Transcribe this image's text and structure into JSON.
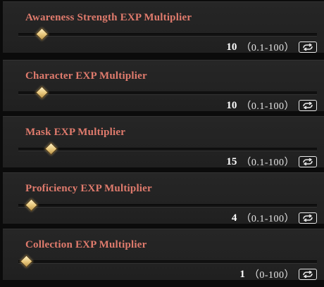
{
  "settings": [
    {
      "label": "Awareness Strength EXP Multiplier",
      "value": "10",
      "range": "（0.1-100）",
      "slider_fraction": 0.099
    },
    {
      "label": "Character EXP Multiplier",
      "value": "10",
      "range": "（0.1-100）",
      "slider_fraction": 0.099
    },
    {
      "label": "Mask EXP Multiplier",
      "value": "15",
      "range": "（0.1-100）",
      "slider_fraction": 0.149
    },
    {
      "label": "Proficiency EXP Multiplier",
      "value": "4",
      "range": "（0.1-100）",
      "slider_fraction": 0.039
    },
    {
      "label": "Collection EXP Multiplier",
      "value": "1",
      "range": "（0-100）",
      "slider_fraction": 0.01
    }
  ],
  "colors": {
    "label": "#e07b6d",
    "knob": "#e7c67a",
    "panel": "#232323"
  },
  "icons": {
    "reset": "reset-cycle-icon"
  }
}
